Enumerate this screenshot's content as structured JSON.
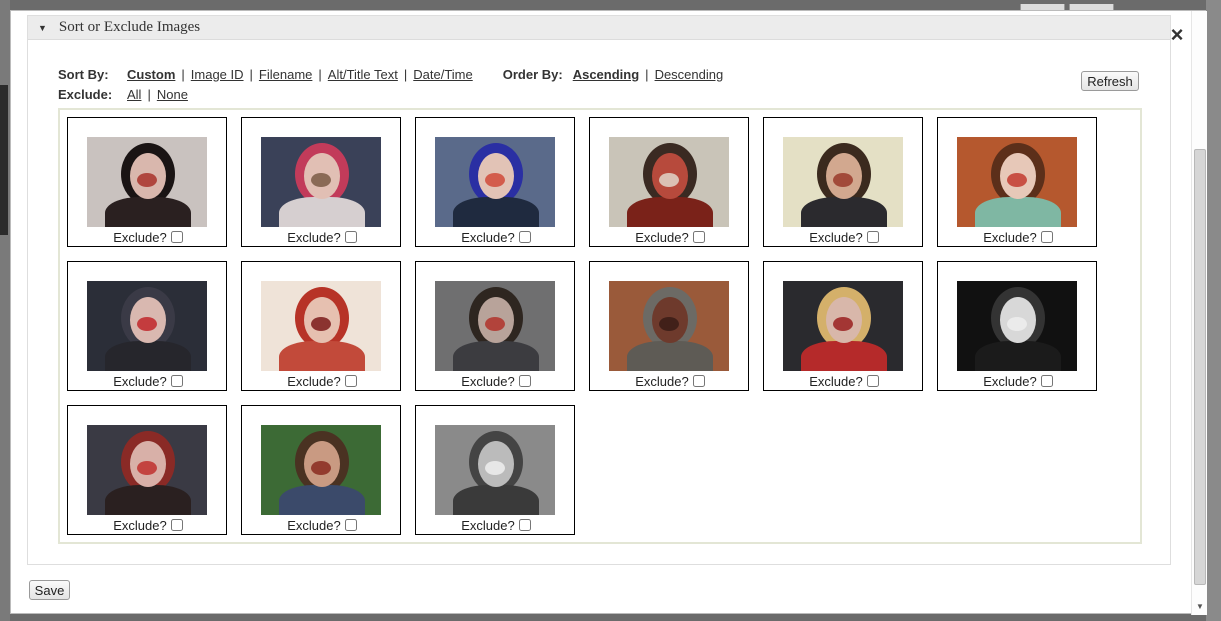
{
  "panel": {
    "title": "Sort or Exclude Images"
  },
  "close_label": "×",
  "sort": {
    "label": "Sort By:",
    "options": [
      "Custom",
      "Image ID",
      "Filename",
      "Alt/Title Text",
      "Date/Time"
    ],
    "active": "Custom"
  },
  "order": {
    "label": "Order By:",
    "options": [
      "Ascending",
      "Descending"
    ],
    "active": "Ascending"
  },
  "exclude": {
    "label": "Exclude:",
    "options": [
      "All",
      "None"
    ]
  },
  "refresh_label": "Refresh",
  "save_label": "Save",
  "exclude_label": "Exclude?",
  "images": [
    {
      "bg": "#c9c2bf",
      "face": "#d9b7ad",
      "hair": "#1a1414",
      "body": "#2a2020",
      "accent": "#a8332a"
    },
    {
      "bg": "#3a4158",
      "face": "#e1bfb4",
      "hair": "#c23b5a",
      "body": "#d6cfd0",
      "accent": "#7a5a45"
    },
    {
      "bg": "#5a6a8a",
      "face": "#e2c3b6",
      "hair": "#2a2fa3",
      "body": "#1f2a3f",
      "accent": "#d04a3a"
    },
    {
      "bg": "#c9c4b8",
      "face": "#b74a3c",
      "hair": "#3a2a22",
      "body": "#7a2219",
      "accent": "#e2d6c9"
    },
    {
      "bg": "#e4e0c5",
      "face": "#d2a88f",
      "hair": "#3b2a1e",
      "body": "#2b2a2e",
      "accent": "#9a3a2a"
    },
    {
      "bg": "#b5582e",
      "face": "#e7c8b8",
      "hair": "#5c2f1a",
      "body": "#7fb7a3",
      "accent": "#c23a2e"
    },
    {
      "bg": "#2b2e38",
      "face": "#d9b8b0",
      "hair": "#3a3a46",
      "body": "#26262c",
      "accent": "#c0262a"
    },
    {
      "bg": "#efe3d8",
      "face": "#e6c0b0",
      "hair": "#b73327",
      "body": "#c24a3a",
      "accent": "#7a1a1a"
    },
    {
      "bg": "#6f6f70",
      "face": "#b8a39a",
      "hair": "#2e2620",
      "body": "#3c3c40",
      "accent": "#b0322a"
    },
    {
      "bg": "#9a5a3a",
      "face": "#6e3a2c",
      "hair": "#6c6a65",
      "body": "#5e5b55",
      "accent": "#3a1c16"
    },
    {
      "bg": "#2a2a2e",
      "face": "#d8b7aa",
      "hair": "#d4b06a",
      "body": "#b52a2a",
      "accent": "#9a2020"
    },
    {
      "bg": "#111111",
      "face": "#d8d8d8",
      "hair": "#333333",
      "body": "#1b1b1b",
      "accent": "#eeeeee"
    },
    {
      "bg": "#3a3a44",
      "face": "#d8b0a8",
      "hair": "#8a2a26",
      "body": "#2a2020",
      "accent": "#c0302e"
    },
    {
      "bg": "#3c6a35",
      "face": "#c99a82",
      "hair": "#4a3222",
      "body": "#3b4a6a",
      "accent": "#8a2a20"
    },
    {
      "bg": "#8a8a8a",
      "face": "#bbbbbb",
      "hair": "#444444",
      "body": "#3a3a3a",
      "accent": "#eeeeee"
    }
  ]
}
